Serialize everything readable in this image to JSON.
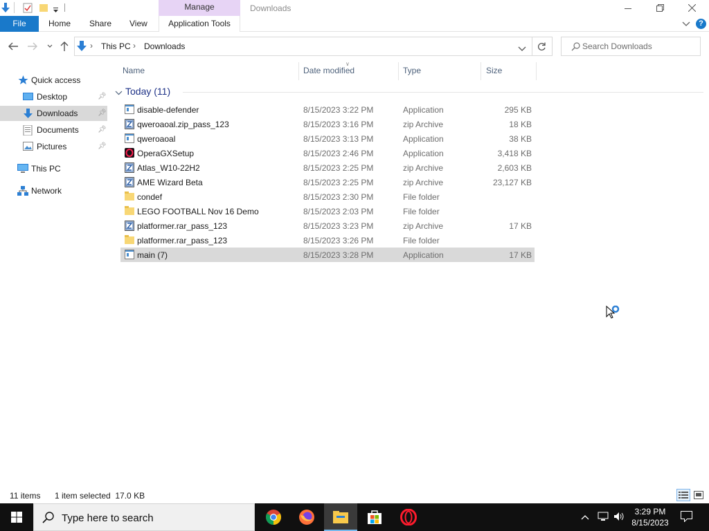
{
  "window": {
    "title": "Downloads",
    "manage_tab": "Manage"
  },
  "ribbon": {
    "file": "File",
    "home": "Home",
    "share": "Share",
    "view": "View",
    "application_tools": "Application Tools"
  },
  "address": {
    "crumbs": [
      "This PC",
      "Downloads"
    ],
    "separator": "›"
  },
  "search": {
    "placeholder": "Search Downloads"
  },
  "nav": {
    "quick_access": "Quick access",
    "desktop": "Desktop",
    "downloads": "Downloads",
    "documents": "Documents",
    "pictures": "Pictures",
    "this_pc": "This PC",
    "network": "Network"
  },
  "columns": {
    "name": "Name",
    "date": "Date modified",
    "type": "Type",
    "size": "Size"
  },
  "group": {
    "label": "Today (11)"
  },
  "files": [
    {
      "name": "disable-defender",
      "date": "8/15/2023 3:22 PM",
      "type": "Application",
      "size": "295 KB",
      "icon": "app-icon"
    },
    {
      "name": "qweroaoal.zip_pass_123",
      "date": "8/15/2023 3:16 PM",
      "type": "zip Archive",
      "size": "18 KB",
      "icon": "zip-icon"
    },
    {
      "name": "qweroaoal",
      "date": "8/15/2023 3:13 PM",
      "type": "Application",
      "size": "38 KB",
      "icon": "app-icon"
    },
    {
      "name": "OperaGXSetup",
      "date": "8/15/2023 2:46 PM",
      "type": "Application",
      "size": "3,418 KB",
      "icon": "opera-gx-icon"
    },
    {
      "name": "Atlas_W10-22H2",
      "date": "8/15/2023 2:25 PM",
      "type": "zip Archive",
      "size": "2,603 KB",
      "icon": "zip-icon"
    },
    {
      "name": "AME Wizard Beta",
      "date": "8/15/2023 2:25 PM",
      "type": "zip Archive",
      "size": "23,127 KB",
      "icon": "zip-icon"
    },
    {
      "name": "condef",
      "date": "8/15/2023 2:30 PM",
      "type": "File folder",
      "size": "",
      "icon": "folder-icon"
    },
    {
      "name": "LEGO FOOTBALL Nov 16 Demo",
      "date": "8/15/2023 2:03 PM",
      "type": "File folder",
      "size": "",
      "icon": "folder-icon"
    },
    {
      "name": "platformer.rar_pass_123",
      "date": "8/15/2023 3:23 PM",
      "type": "zip Archive",
      "size": "17 KB",
      "icon": "zip-icon"
    },
    {
      "name": "platformer.rar_pass_123",
      "date": "8/15/2023 3:26 PM",
      "type": "File folder",
      "size": "",
      "icon": "folder-icon"
    },
    {
      "name": "main (7)",
      "date": "8/15/2023 3:28 PM",
      "type": "Application",
      "size": "17 KB",
      "icon": "app-icon"
    }
  ],
  "status": {
    "items": "11 items",
    "selected": "1 item selected  17.0 KB"
  },
  "taskbar": {
    "search_placeholder": "Type here to search",
    "time": "3:29 PM",
    "date": "8/15/2023"
  },
  "colors": {
    "accent": "#1979ca",
    "manage_tab": "#e7d4f5",
    "selection": "#d9d9d9",
    "taskbar": "#101010"
  }
}
